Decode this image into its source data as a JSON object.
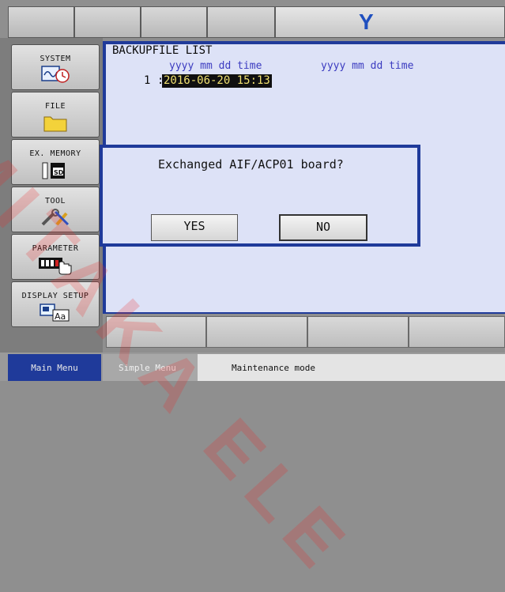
{
  "top_bar": {
    "logo": "Y"
  },
  "sidebar": {
    "items": [
      {
        "label": "SYSTEM",
        "icon": "system-icon"
      },
      {
        "label": "FILE",
        "icon": "folder-icon"
      },
      {
        "label": "EX. MEMORY",
        "icon": "sd-card-icon"
      },
      {
        "label": "TOOL",
        "icon": "tool-icon"
      },
      {
        "label": "PARAMETER",
        "icon": "parameter-hand-icon"
      },
      {
        "label": "DISPLAY SETUP",
        "icon": "display-setup-icon"
      }
    ]
  },
  "panel": {
    "title": "BACKUPFILE LIST",
    "col_header_1": "yyyy mm dd  time",
    "col_header_2": "yyyy mm dd  time",
    "row_index": "1 :",
    "row_value": "2016-06-20 15:13"
  },
  "dialog": {
    "message": "Exchanged AIF/ACP01 board?",
    "yes_label": "YES",
    "no_label": "NO"
  },
  "bottom_bar": {
    "main_menu": "Main Menu",
    "simple_menu": "Simple Menu",
    "status": "Maintenance mode"
  },
  "watermark": "MITAKA ELE",
  "colors": {
    "accent": "#1f3a9a",
    "panel_bg": "#dde2f7",
    "highlight": "#101010"
  }
}
